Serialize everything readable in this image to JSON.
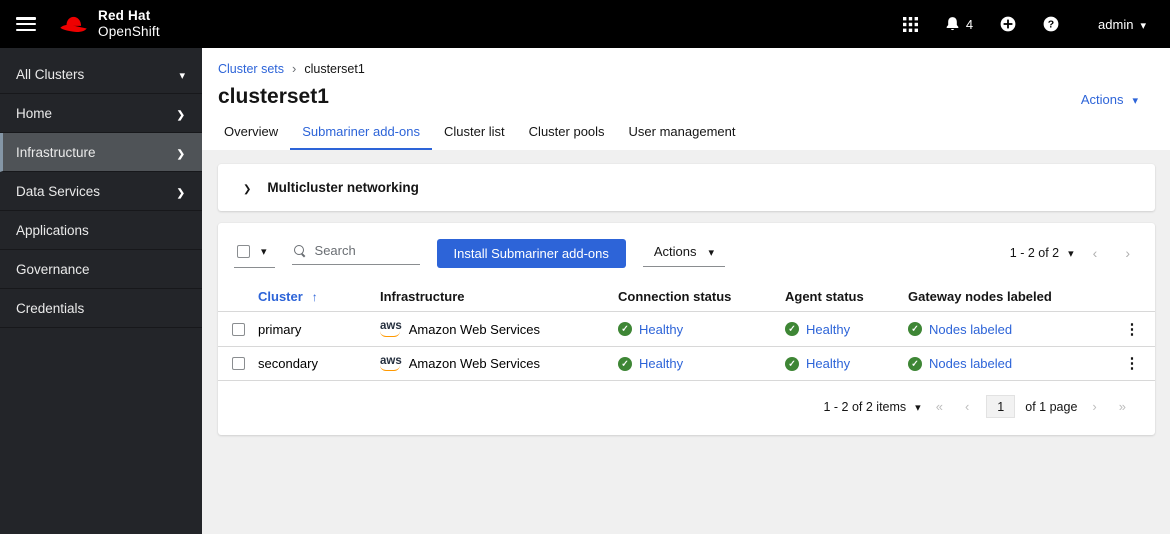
{
  "colors": {
    "accent_blue": "#2d64d8",
    "success_green": "#3e8635",
    "brand_red": "#ee0000",
    "header_bg": "#000000",
    "sidebar_bg": "#232529",
    "content_bg": "#f0f0f0"
  },
  "header": {
    "brand_line1": "Red Hat",
    "brand_line2": "OpenShift",
    "notification_count": "4",
    "username": "admin"
  },
  "sidebar": {
    "context_switcher": "All Clusters",
    "items": [
      {
        "label": "Home"
      },
      {
        "label": "Infrastructure"
      },
      {
        "label": "Data Services"
      },
      {
        "label": "Applications"
      },
      {
        "label": "Governance"
      },
      {
        "label": "Credentials"
      }
    ]
  },
  "breadcrumb": {
    "parent": "Cluster sets",
    "current": "clusterset1"
  },
  "page": {
    "title": "clusterset1",
    "actions_label": "Actions"
  },
  "tabs": [
    "Overview",
    "Submariner add-ons",
    "Cluster list",
    "Cluster pools",
    "User management"
  ],
  "expandable_section": {
    "title": "Multicluster networking"
  },
  "toolbar": {
    "search_placeholder": "Search",
    "install_button_label": "Install Submariner add-ons",
    "actions_label": "Actions",
    "pagination_label": "1 - 2 of 2"
  },
  "table": {
    "columns": {
      "cluster": "Cluster",
      "infrastructure": "Infrastructure",
      "connection_status": "Connection status",
      "agent_status": "Agent status",
      "gateway": "Gateway nodes labeled"
    },
    "rows": [
      {
        "cluster": "primary",
        "provider_short": "aws",
        "provider": "Amazon Web Services",
        "connection_status": "Healthy",
        "agent_status": "Healthy",
        "gateway": "Nodes labeled"
      },
      {
        "cluster": "secondary",
        "provider_short": "aws",
        "provider": "Amazon Web Services",
        "connection_status": "Healthy",
        "agent_status": "Healthy",
        "gateway": "Nodes labeled"
      }
    ]
  },
  "bottom_pagination": {
    "items_label": "1 - 2 of 2 items",
    "current_page": "1",
    "page_count_label": "of 1 page"
  }
}
